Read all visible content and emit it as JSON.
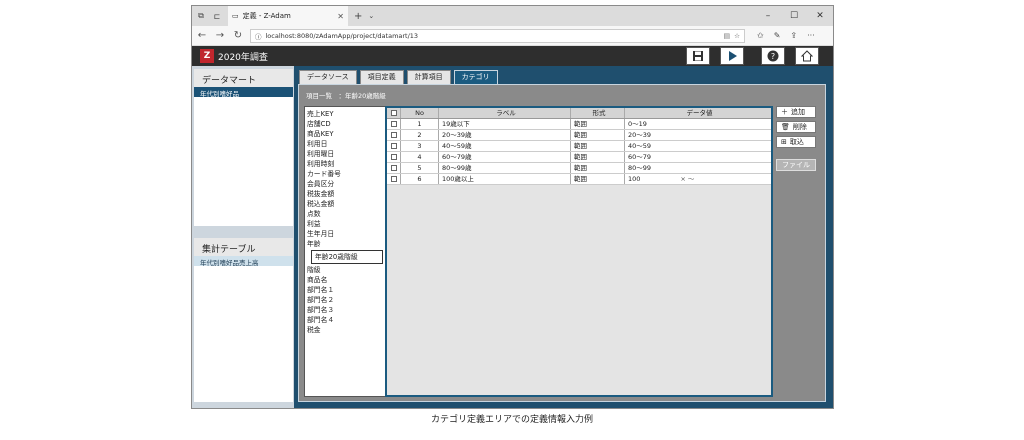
{
  "browser": {
    "tab_title": "定義 - Z-Adam",
    "url": "localhost:8080/zAdamApp/project/datamart/13"
  },
  "app": {
    "title": "2020年調査",
    "logo_letter": "Z"
  },
  "left_panel": {
    "datamart_header": "データマート",
    "datamart_item": "年代別嗜好品",
    "table_header": "集計テーブル",
    "table_item": "年代別嗜好品売上高"
  },
  "tabs": [
    "データソース",
    "項目定義",
    "計算項目",
    "カテゴリ"
  ],
  "active_tab": "カテゴリ",
  "list_header": "項目一覧　：年齢20歳階級",
  "fields_before": [
    "売上KEY",
    "店舗CD",
    "商品KEY",
    "利用日",
    "利用曜日",
    "利用時刻",
    "カード番号",
    "会員区分",
    "税抜金額",
    "税込金額",
    "点数",
    "利益",
    "生年月日",
    "年齢"
  ],
  "edit_field": "年齢20歳階級",
  "fields_after": [
    "階級",
    "商品名",
    "部門名１",
    "部門名２",
    "部門名３",
    "部門名４",
    "税金"
  ],
  "grid": {
    "headers": [
      "No",
      "ラベル",
      "形式",
      "データ値"
    ],
    "rows": [
      {
        "no": "1",
        "label": "19歳以下",
        "type": "範囲",
        "value": "0～19",
        "extra": ""
      },
      {
        "no": "2",
        "label": "20～39歳",
        "type": "範囲",
        "value": "20～39",
        "extra": ""
      },
      {
        "no": "3",
        "label": "40～59歳",
        "type": "範囲",
        "value": "40～59",
        "extra": ""
      },
      {
        "no": "4",
        "label": "60～79歳",
        "type": "範囲",
        "value": "60～79",
        "extra": ""
      },
      {
        "no": "5",
        "label": "80～99歳",
        "type": "範囲",
        "value": "80～99",
        "extra": ""
      },
      {
        "no": "6",
        "label": "100歳以上",
        "type": "範囲",
        "value": "100",
        "extra": "× ～"
      }
    ]
  },
  "buttons": {
    "add": "追加",
    "delete": "削除",
    "import": "取込",
    "file": "ファイル"
  },
  "caption": "カテゴリ定義エリアでの定義情報入力例",
  "colors": {
    "frame_blue": "#1f4f6e",
    "active_tab": "#1b5b80",
    "logo_red": "#c0262d"
  }
}
